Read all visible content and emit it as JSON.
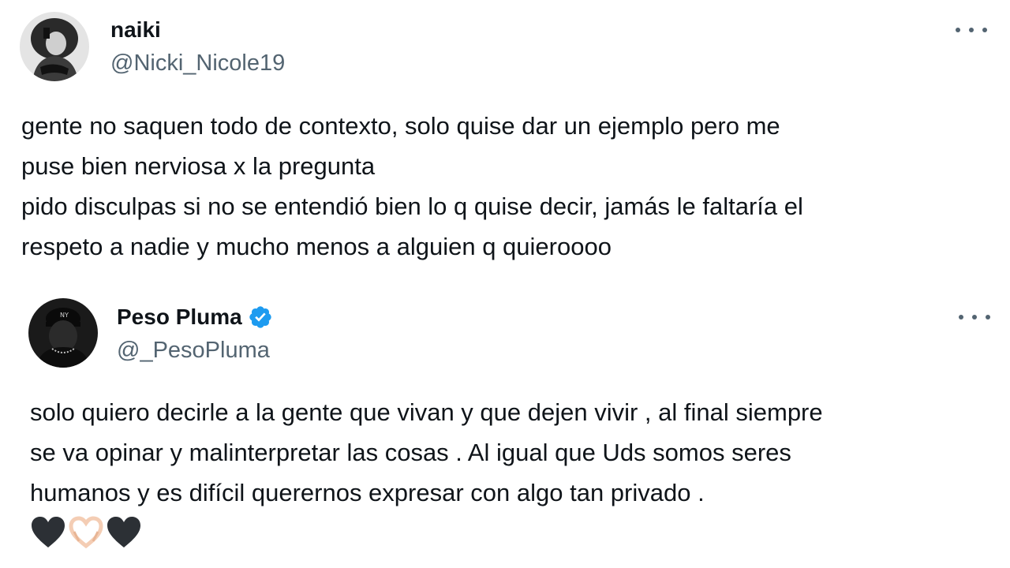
{
  "tweets": [
    {
      "display_name": "naiki",
      "handle": "@Nicki_Nicole19",
      "verified": false,
      "avatar_icon": "profile-photo-grayscale",
      "text_lines": [
        "gente no saquen todo de contexto, solo quise dar un ejemplo pero me",
        "puse bien nerviosa x la pregunta",
        "pido disculpas si no se entendió bien lo q quise decir, jamás le faltaría el",
        "respeto a nadie y mucho menos a alguien q quieroooo"
      ]
    },
    {
      "display_name": "Peso Pluma",
      "handle": "@_PesoPluma",
      "verified": true,
      "verified_color": "#1d9bf0",
      "avatar_icon": "profile-photo-dark",
      "text_lines": [
        "solo quiero decirle a la gente que vivan y que dejen vivir , al final siempre",
        "se va opinar y malinterpretar las cosas . Al igual que Uds somos seres",
        "humanos y es difícil querernos expresar con algo tan privado ."
      ],
      "emojis": [
        "black-heart",
        "heart-hands",
        "black-heart"
      ]
    }
  ],
  "more_icon": "more-options-icon"
}
